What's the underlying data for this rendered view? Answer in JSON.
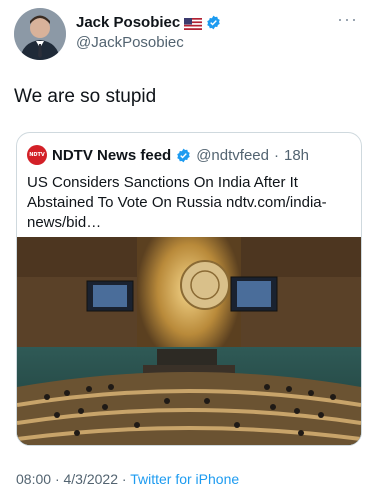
{
  "tweet": {
    "display_name": "Jack Posobiec",
    "handle": "@JackPosobiec",
    "text": "We are so stupid",
    "more_label": "···",
    "time": "08:00",
    "sep1": "·",
    "date": "4/3/2022",
    "sep2": "·",
    "source": "Twitter for iPhone"
  },
  "quote": {
    "logo_text": "NDTV",
    "name": "NDTV News feed",
    "handle": "@ndtvfeed",
    "sep": "·",
    "time": "18h",
    "text": "US Considers Sanctions On India After It Abstained To Vote On Russia ndtv.com/india-news/bid…"
  },
  "colors": {
    "verified": "#1d9bf0",
    "link": "#1d9bf0",
    "secondary_text": "#536471",
    "ndtv_red": "#d32027"
  }
}
